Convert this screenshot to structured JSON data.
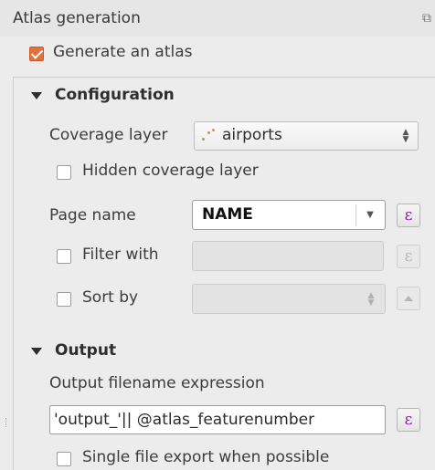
{
  "panel": {
    "title": "Atlas generation",
    "generate_atlas": {
      "label": "Generate an atlas",
      "checked": true
    }
  },
  "configuration": {
    "header": "Configuration",
    "coverage_layer": {
      "label": "Coverage layer",
      "value": "airports"
    },
    "hidden_coverage": {
      "label": "Hidden coverage layer",
      "checked": false
    },
    "page_name": {
      "label": "Page name",
      "value": "NAME"
    },
    "filter_with": {
      "label": "Filter with",
      "checked": false,
      "value": ""
    },
    "sort_by": {
      "label": "Sort by",
      "checked": false,
      "value": ""
    }
  },
  "output": {
    "header": "Output",
    "filename_label": "Output filename expression",
    "filename_value": "'output_'|| @atlas_featurenumber",
    "single_file": {
      "label": "Single file export when possible",
      "checked": false
    }
  },
  "icons": {
    "expression": "ε",
    "float": "⧉"
  },
  "colors": {
    "checkbox_checked": "#e5703a",
    "expression_icon": "#7a2a8c"
  }
}
